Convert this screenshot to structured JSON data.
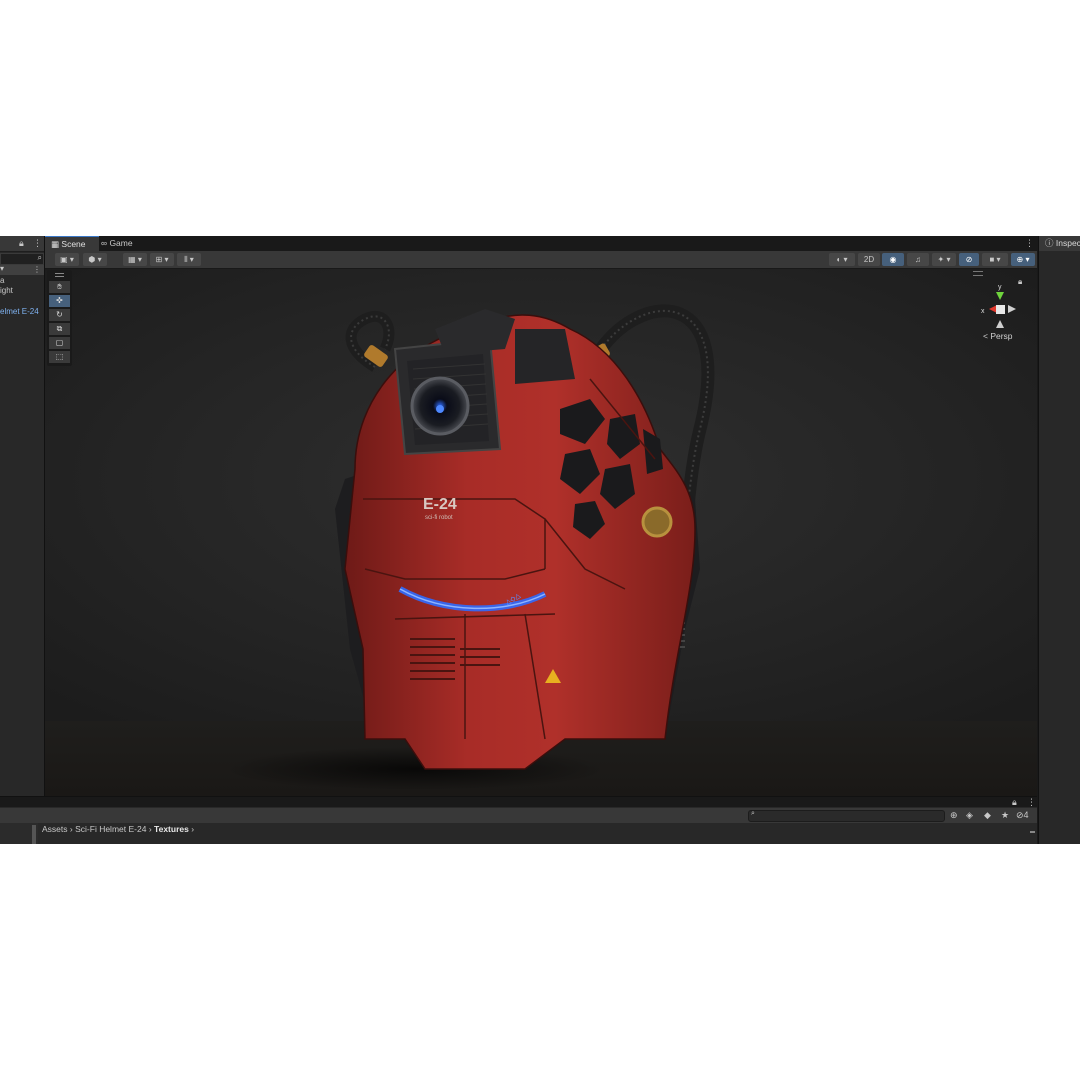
{
  "hierarchy": {
    "items": [
      {
        "label": "a"
      },
      {
        "label": "ight"
      },
      {
        "label": "elmet E-24"
      }
    ],
    "icons": [
      "lock-icon",
      "kebab-menu-icon",
      "search-icon"
    ]
  },
  "scene_view": {
    "tabs": [
      {
        "label": "Scene",
        "icon": "grid-icon"
      },
      {
        "label": "Game",
        "icon": "gamepad-icon"
      }
    ],
    "toolbar": {
      "mode_2d_label": "2D"
    },
    "tools": [
      "hand-tool",
      "move-tool",
      "rotate-tool",
      "scale-tool",
      "rect-tool",
      "transform-tool"
    ],
    "active_tool": "move-tool",
    "gizmo": {
      "axis_x_label": "x",
      "axis_y_label": "y",
      "projection_label": "Persp"
    },
    "model": {
      "marking_main": "E-24",
      "marking_sub": "sci-fi robot",
      "colors": {
        "hull": "#b0302a",
        "frame": "#2a2a2c",
        "glow": "#2e6cff",
        "brass": "#b07a2c"
      }
    }
  },
  "inspector": {
    "tab_label": "Inspect"
  },
  "project": {
    "breadcrumb": [
      "Assets",
      "Sci-Fi Helmet E-24",
      "Textures"
    ],
    "visibility_count": "4"
  }
}
